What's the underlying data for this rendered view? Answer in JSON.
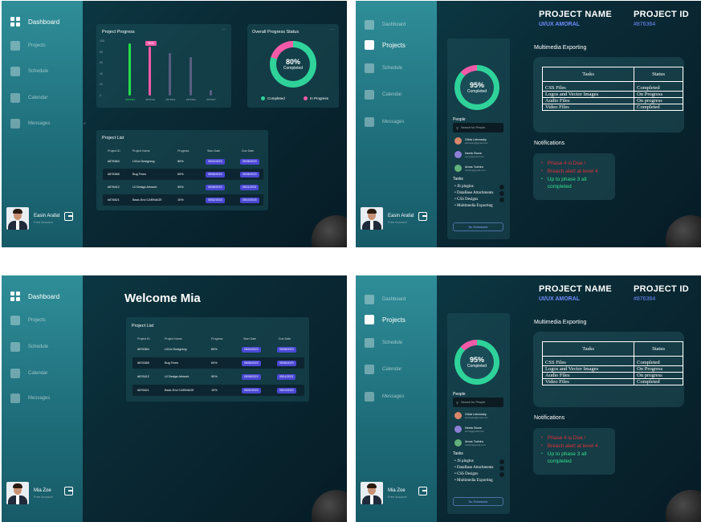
{
  "nav": {
    "dashboard": "Dashboard",
    "projects": "Projects",
    "schedule": "Schedule",
    "calendar": "Calendar",
    "messages": "Messages"
  },
  "colors": {
    "accent": "#4b48d6",
    "completed": "#2fd39a",
    "in_progress": "#f55aa8",
    "bar_green": "#24e04a",
    "sidebar": "#2f8e98"
  },
  "users": {
    "user1": {
      "name": "Easin Arafat",
      "role": "Free Account"
    },
    "user2": {
      "name": "Mia Zoe",
      "role": "Free Account"
    }
  },
  "dashboard": {
    "progress_title": "Project Progress",
    "overall_title": "Overall Progress Status",
    "donut_value": "80%",
    "donut_label": "Completed",
    "legend_completed": "Completed",
    "legend_in_progress": "In Progress",
    "tooltip": "95%",
    "project_list_title": "Project List"
  },
  "chart_data": {
    "type": "bar",
    "title": "Project Progress",
    "categories": [
      "#876364",
      "#876361",
      "#876362",
      "#876363",
      "#876367"
    ],
    "values": [
      95,
      90,
      78,
      70,
      10
    ],
    "highlight_index": 1,
    "ytick_labels": [
      "100",
      "80",
      "60",
      "40",
      "20",
      "0"
    ],
    "ylim": [
      0,
      100
    ]
  },
  "project_list": {
    "headers": [
      "Project ID",
      "Project Name",
      "Progress",
      "Start Date",
      "Due Date"
    ],
    "rows": [
      {
        "id": "#876364",
        "name": "UI/Ux Designing",
        "progress": "80%",
        "start": "05/04/2023",
        "due": "05/08/2023"
      },
      {
        "id": "#876368",
        "name": "Bug Fixes",
        "progress": "60%",
        "start": "05/06/2023",
        "due": "05/06/2023"
      },
      {
        "id": "#876412",
        "name": "UI Design Artwork",
        "progress": "90%",
        "start": "05/08/2023",
        "due": "05/11/2023"
      },
      {
        "id": "#876621",
        "name": "Back-End CARMAGE",
        "progress": "10%",
        "start": "05/02/2023",
        "due": "05/10/2023"
      }
    ]
  },
  "welcome": "Welcome  Mia",
  "project_detail": {
    "name_label": "PROJECT  NAME",
    "name_value": "UI/UX  AMORAL",
    "id_label": "PROJECT  ID",
    "id_value": "#876364",
    "donut_value": "95%",
    "donut_label": "Completed",
    "people_label": "People",
    "search_placeholder": "Search for People",
    "people": [
      {
        "name": "Gilda Lebowsky",
        "email": "lebowsky@gmail.com",
        "color": "#d8866a"
      },
      {
        "name": "Neela Stone",
        "email": "stone@gmail.com",
        "color": "#8f7fd6"
      },
      {
        "name": "Amos Toshiro",
        "email": "toshiro@gmail.com",
        "color": "#63b27a"
      }
    ],
    "tasks_label": "Tasks",
    "tasks": [
      "JS plugins",
      "DataBase Attachments",
      "CSS Designs",
      "Multimedia Exporting"
    ],
    "schedule_button": "No Scheduled",
    "mm_title": "Multimedia Exporting",
    "mm_headers": [
      "Tasks",
      "Status"
    ],
    "mm_rows": [
      {
        "task": "CSS Files",
        "status": "Completed"
      },
      {
        "task": "Logos and Vector Images",
        "status": "On Progress"
      },
      {
        "task": "Audio Files",
        "status": "On progress"
      },
      {
        "task": "Video Files",
        "status": "Completed"
      }
    ],
    "notif_title": "Notifications",
    "notifications": [
      {
        "text": "Phase 4 is Due !",
        "color": "#e0303a"
      },
      {
        "text": "Breach alert at level 4",
        "color": "#e0303a"
      },
      {
        "text": "Up to phase 3 all completed",
        "color": "#33e08a"
      }
    ]
  }
}
